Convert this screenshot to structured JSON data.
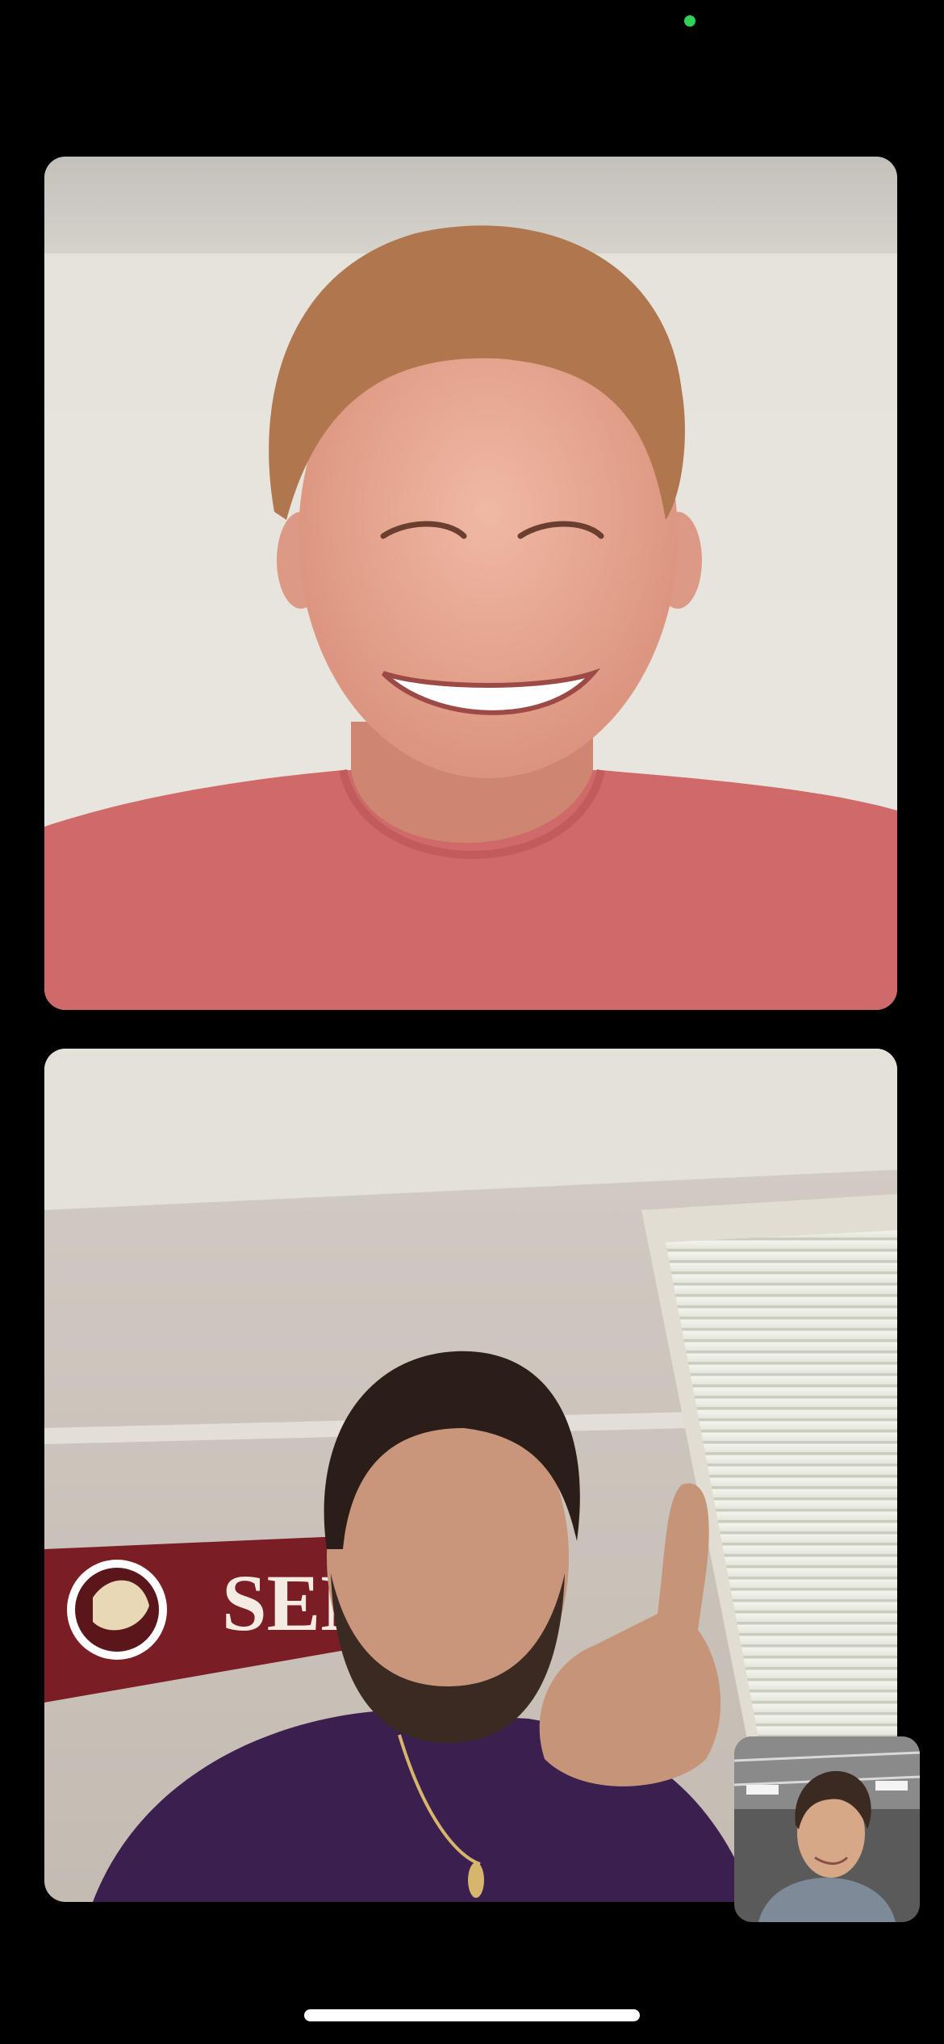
{
  "call": {
    "camera_indicator_color": "#30d158",
    "participants": [
      {
        "role": "remote",
        "position": "top",
        "shirt_color": "#d06a6a",
        "background": "#e6e2dc"
      },
      {
        "role": "remote",
        "position": "bottom",
        "shirt_color": "#3a1f4f",
        "background": "#cfc8c0"
      }
    ],
    "self_view": {
      "role": "self-preview",
      "position": "bottom-right"
    }
  },
  "pennant": {
    "text": "SEM",
    "color": "#7a1d24"
  },
  "home_indicator_color": "#ffffff"
}
